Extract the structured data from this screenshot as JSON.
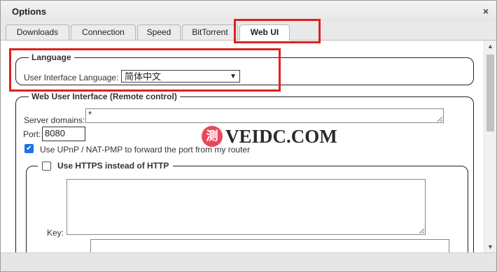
{
  "window": {
    "title": "Options",
    "close_glyph": "×"
  },
  "tabs": [
    {
      "label": "Downloads"
    },
    {
      "label": "Connection"
    },
    {
      "label": "Speed"
    },
    {
      "label": "BitTorrent"
    },
    {
      "label": "Web UI",
      "active": true
    }
  ],
  "language": {
    "legend": "Language",
    "ui_language_label": "User Interface Language:",
    "ui_language_value": "简体中文"
  },
  "webui": {
    "legend": "Web User Interface (Remote control)",
    "server_domains_label": "Server domains:",
    "server_domains_value": "*",
    "port_label": "Port:",
    "port_value": "8080",
    "upnp_label": "Use UPnP / NAT-PMP to forward the port from my router",
    "upnp_checked": true,
    "https": {
      "legend": "Use HTTPS instead of HTTP",
      "checked": false,
      "key_label": "Key:"
    }
  },
  "watermark": {
    "logo_char": "测",
    "text": "VEIDC.COM"
  },
  "colors": {
    "highlight": "#e02020",
    "checkbox_on": "#1a73e8",
    "watermark_logo": "#e8495a"
  }
}
